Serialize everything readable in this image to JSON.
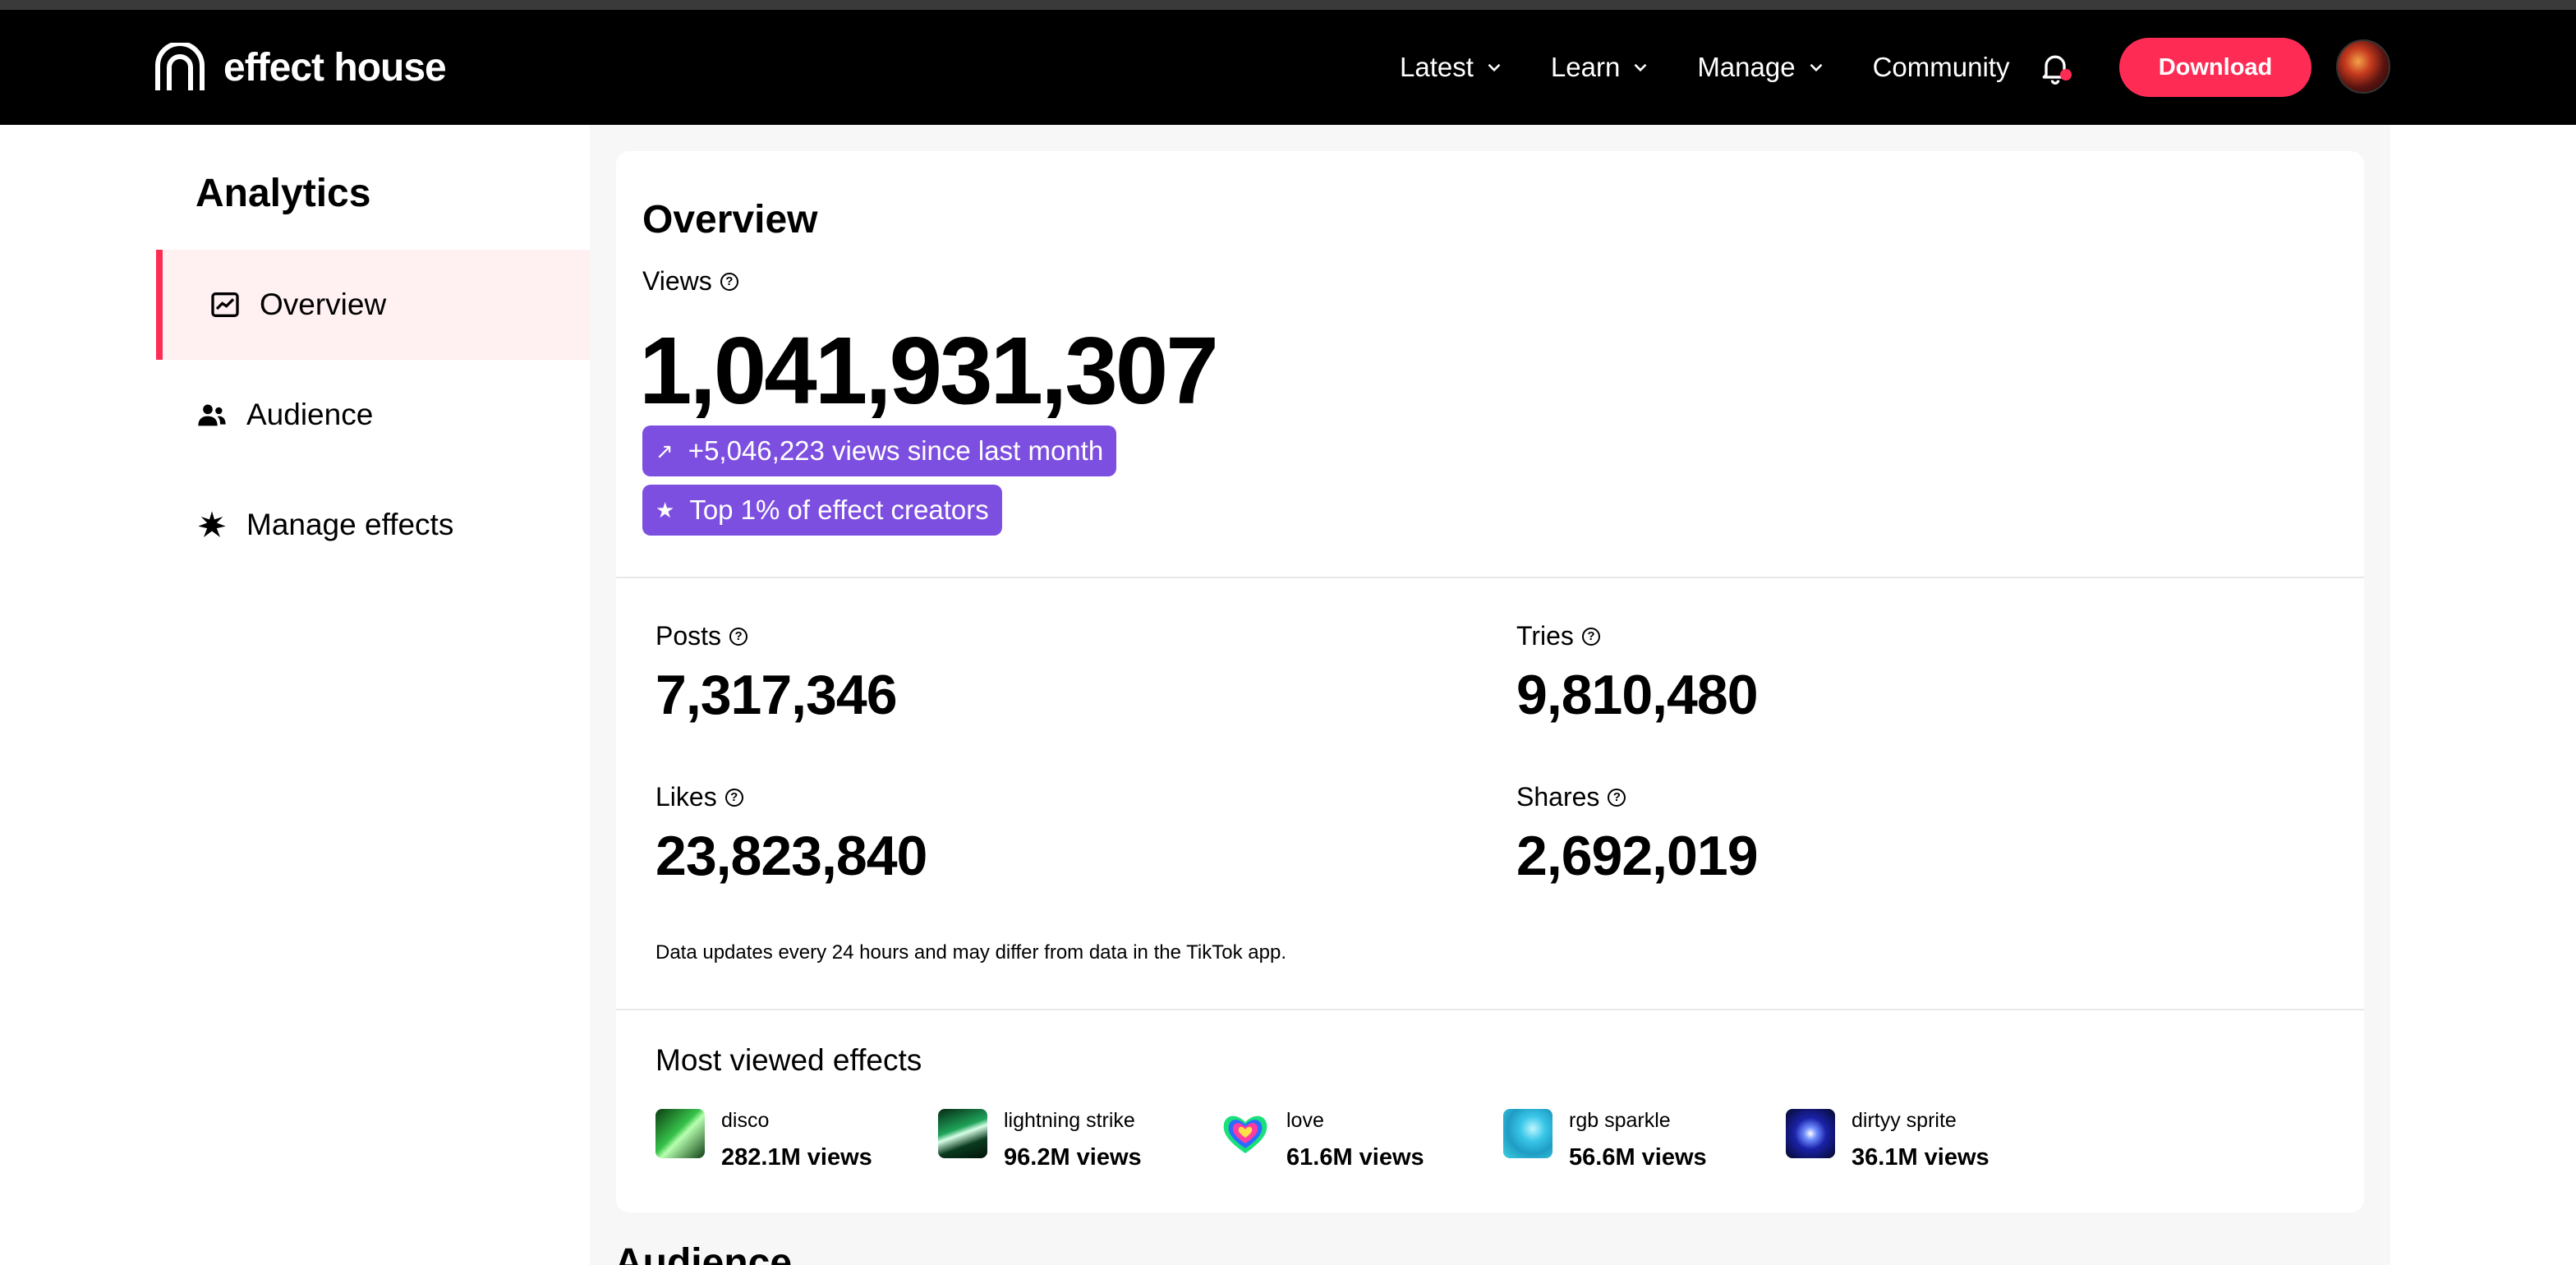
{
  "header": {
    "logo_text": "effect house",
    "nav": [
      {
        "label": "Latest",
        "has_dropdown": true
      },
      {
        "label": "Learn",
        "has_dropdown": true
      },
      {
        "label": "Manage",
        "has_dropdown": true
      },
      {
        "label": "Community",
        "has_dropdown": false
      }
    ],
    "download_label": "Download",
    "accent_color": "#fe2c55"
  },
  "sidebar": {
    "title": "Analytics",
    "items": [
      {
        "label": "Overview",
        "icon": "chart-icon",
        "active": true
      },
      {
        "label": "Audience",
        "icon": "users-icon",
        "active": false
      },
      {
        "label": "Manage effects",
        "icon": "sparkle-icon",
        "active": false
      }
    ]
  },
  "overview": {
    "title": "Overview",
    "views_label": "Views",
    "views_value": "1,041,931,307",
    "badge_growth": "+5,046,223 views since last month",
    "badge_rank": "Top 1% of effect creators",
    "badge_color": "#7d4fe0",
    "stats": {
      "posts": {
        "label": "Posts",
        "value": "7,317,346"
      },
      "tries": {
        "label": "Tries",
        "value": "9,810,480"
      },
      "likes": {
        "label": "Likes",
        "value": "23,823,840"
      },
      "shares": {
        "label": "Shares",
        "value": "2,692,019"
      }
    },
    "note": "Data updates every 24 hours and may differ from data in the TikTok app."
  },
  "most_viewed": {
    "title": "Most viewed effects",
    "effects": [
      {
        "name": "disco",
        "views": "282.1M views"
      },
      {
        "name": "lightning strike",
        "views": "96.2M views"
      },
      {
        "name": "love",
        "views": "61.6M views"
      },
      {
        "name": "rgb sparkle",
        "views": "56.6M views"
      },
      {
        "name": "dirtyy sprite",
        "views": "36.1M views"
      }
    ]
  },
  "next_section": {
    "title": "Audience"
  }
}
